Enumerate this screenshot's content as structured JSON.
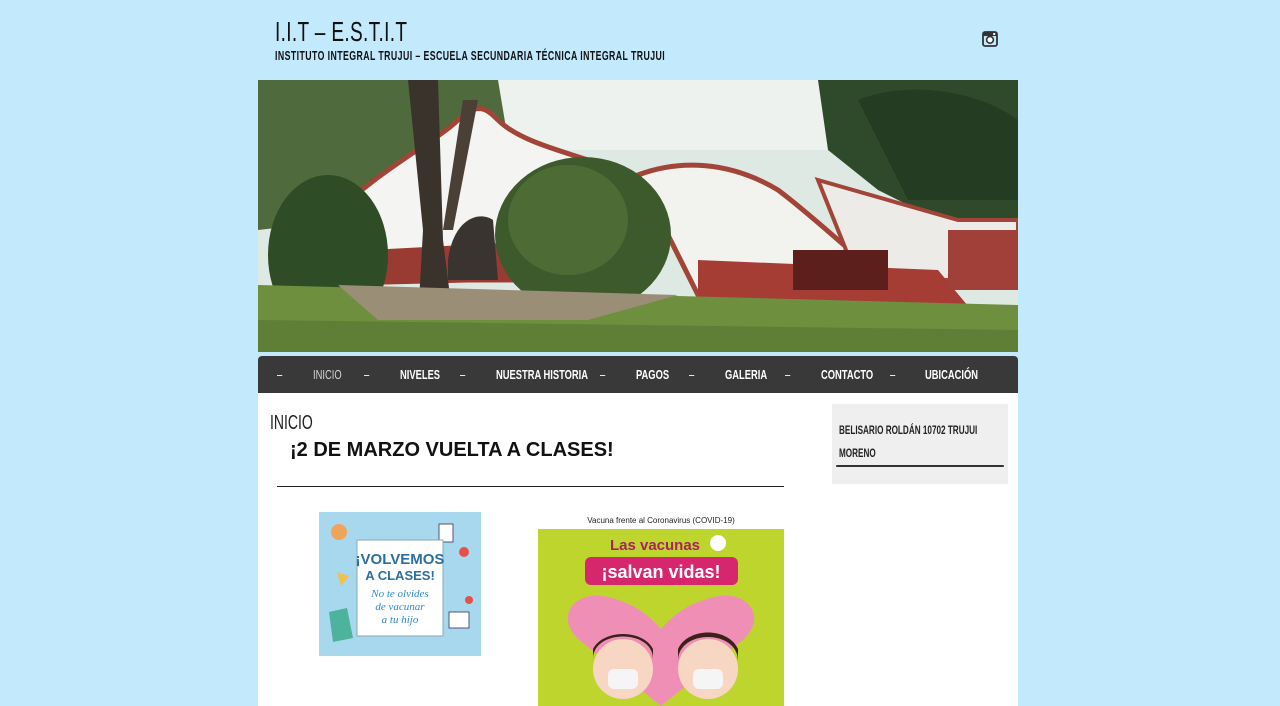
{
  "site": {
    "title": "I.I.T – E.S.T.I.T",
    "description": "INSTITUTO INTEGRAL TRUJUI – ESCUELA SECUNDARIA TÉCNICA INTEGRAL TRUJUI"
  },
  "social": {
    "icon": "instagram-icon"
  },
  "nav": {
    "separator": "–",
    "items": [
      {
        "label": "INICIO",
        "active": true
      },
      {
        "label": "NIVELES"
      },
      {
        "label": "NUESTRA HISTORIA"
      },
      {
        "label": "PAGOS"
      },
      {
        "label": "GALERIA"
      },
      {
        "label": "CONTACTO"
      },
      {
        "label": "UBICACIÓN"
      }
    ]
  },
  "page": {
    "title": "INICIO",
    "post_title": "¡2 DE MARZO VUELTA A CLASES!"
  },
  "images": {
    "volvemos": {
      "line1": "¡VOLVEMOS",
      "line2": "A CLASES!",
      "line3": "No te olvides",
      "line4": "de vacunar",
      "line5": "a tu hijo"
    },
    "vacuna": {
      "caption": "Vacuna frente al Coronavirus (COVID-19)",
      "line1": "Las vacunas",
      "line2": "¡salvan vidas!"
    }
  },
  "sidebar": {
    "address": "BELISARIO ROLDÁN 10702 TRUJUI MORENO"
  },
  "colors": {
    "page_bg": "#c3e9fc",
    "nav_bg": "#393939",
    "widget_bg": "#efefef"
  }
}
